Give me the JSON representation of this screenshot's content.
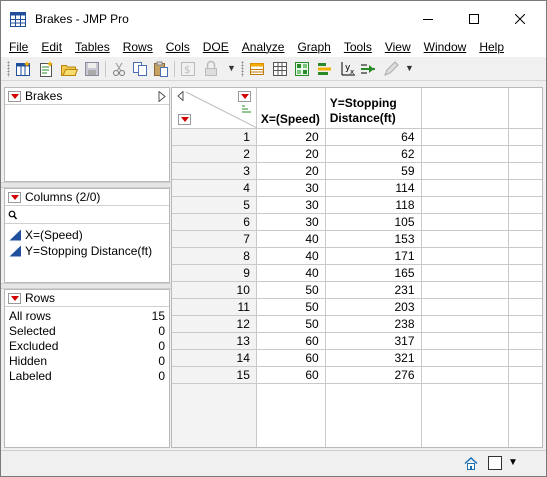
{
  "window": {
    "title": "Brakes - JMP Pro",
    "app_icon": "jmp-table-icon"
  },
  "menu": [
    "File",
    "Edit",
    "Tables",
    "Rows",
    "Cols",
    "DOE",
    "Analyze",
    "Graph",
    "Tools",
    "View",
    "Window",
    "Help"
  ],
  "toolbar": {
    "icons": [
      "new-data-table-icon",
      "new-script-icon",
      "open-icon",
      "save-icon",
      "cut-icon",
      "copy-icon",
      "paste-icon",
      "subset-icon",
      "lock-icon",
      "data-grid-icon",
      "tables-icon",
      "fit-model-icon",
      "graph-builder-icon",
      "distribution-icon",
      "control-chart-icon",
      "pen-icon"
    ]
  },
  "table_panel": {
    "title": "Brakes"
  },
  "columns_panel": {
    "title": "Columns (2/0)",
    "search_placeholder": "",
    "items": [
      "X=(Speed)",
      "Y=Stopping Distance(ft)"
    ]
  },
  "rows_panel": {
    "title": "Rows",
    "items": [
      {
        "label": "All rows",
        "value": "15"
      },
      {
        "label": "Selected",
        "value": "0"
      },
      {
        "label": "Excluded",
        "value": "0"
      },
      {
        "label": "Hidden",
        "value": "0"
      },
      {
        "label": "Labeled",
        "value": "0"
      }
    ]
  },
  "grid": {
    "columns": [
      "X=(Speed)",
      "Y=Stopping Distance(ft)"
    ],
    "col2_line1": "Y=Stopping",
    "col2_line2": "Distance(ft)",
    "rows": [
      [
        "1",
        "20",
        "64"
      ],
      [
        "2",
        "20",
        "62"
      ],
      [
        "3",
        "20",
        "59"
      ],
      [
        "4",
        "30",
        "114"
      ],
      [
        "5",
        "30",
        "118"
      ],
      [
        "6",
        "30",
        "105"
      ],
      [
        "7",
        "40",
        "153"
      ],
      [
        "8",
        "40",
        "171"
      ],
      [
        "9",
        "40",
        "165"
      ],
      [
        "10",
        "50",
        "231"
      ],
      [
        "11",
        "50",
        "203"
      ],
      [
        "12",
        "50",
        "238"
      ],
      [
        "13",
        "60",
        "317"
      ],
      [
        "14",
        "60",
        "321"
      ],
      [
        "15",
        "60",
        "276"
      ]
    ]
  },
  "colors": {
    "red_triangle": "#d40000",
    "column_icon": "#1f4e9c",
    "row_header_bg": "#f3f3f3"
  }
}
